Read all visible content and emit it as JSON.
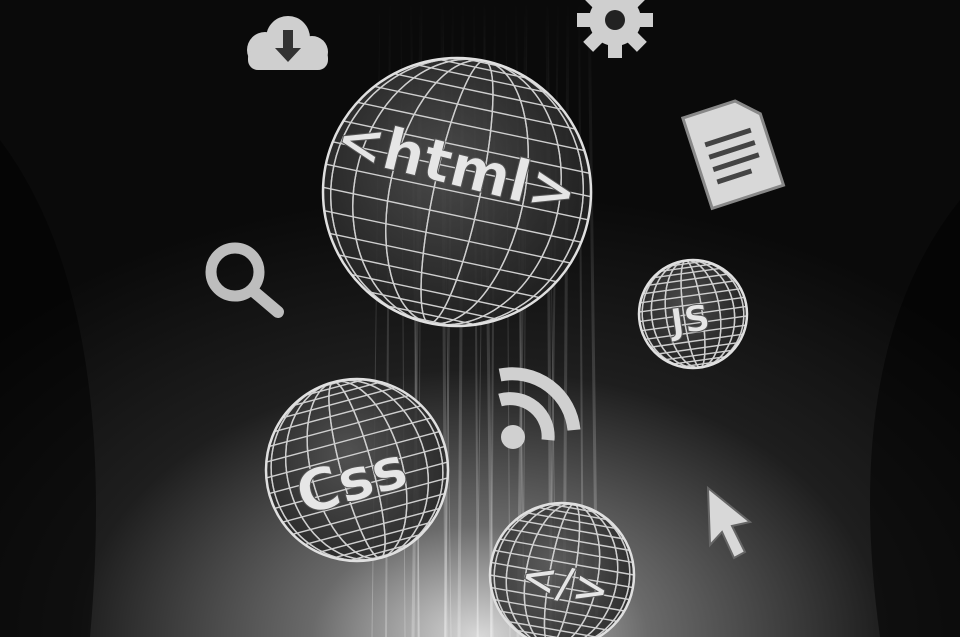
{
  "spheres": {
    "html": {
      "text": "<html>"
    },
    "js": {
      "text": "JS"
    },
    "css": {
      "text": "Css"
    },
    "code": {
      "text": "</>"
    }
  },
  "icons": [
    "cloud-download-icon",
    "gear-icon",
    "document-icon",
    "magnifier-icon",
    "wifi-icon",
    "cursor-icon"
  ],
  "colors": {
    "background": "#0a0a0a",
    "glow": "#d9d9d9",
    "icon": "#cfcfcf"
  }
}
